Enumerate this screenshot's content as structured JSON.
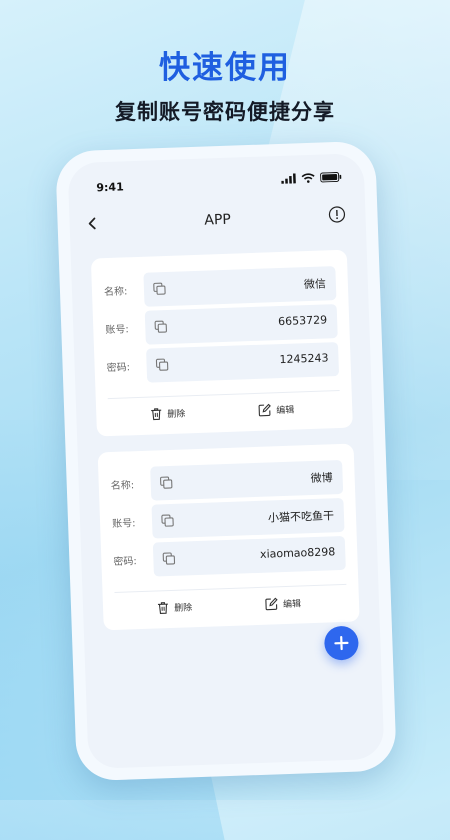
{
  "promo": {
    "headline": "快速使用",
    "subline": "复制账号密码便捷分享"
  },
  "status_bar": {
    "time": "9:41",
    "icons": [
      "signal-icon",
      "wifi-icon",
      "battery-icon"
    ]
  },
  "nav": {
    "title": "APP",
    "back_icon": "chevron-left-icon",
    "info_icon": "info-icon"
  },
  "accounts": [
    {
      "name_label": "名称:",
      "name": "微信",
      "account_label": "账号:",
      "account": "6653729",
      "password_label": "密码:",
      "password": "1245243",
      "delete_label": "删除",
      "edit_label": "编辑"
    },
    {
      "name_label": "名称:",
      "name": "微博",
      "account_label": "账号:",
      "account": "小猫不吃鱼干",
      "password_label": "密码:",
      "password": "xiaomao8298",
      "delete_label": "删除",
      "edit_label": "编辑"
    }
  ],
  "colors": {
    "accent": "#2e67ee",
    "headline": "#1f5fe0"
  },
  "fab_icon": "plus-icon"
}
